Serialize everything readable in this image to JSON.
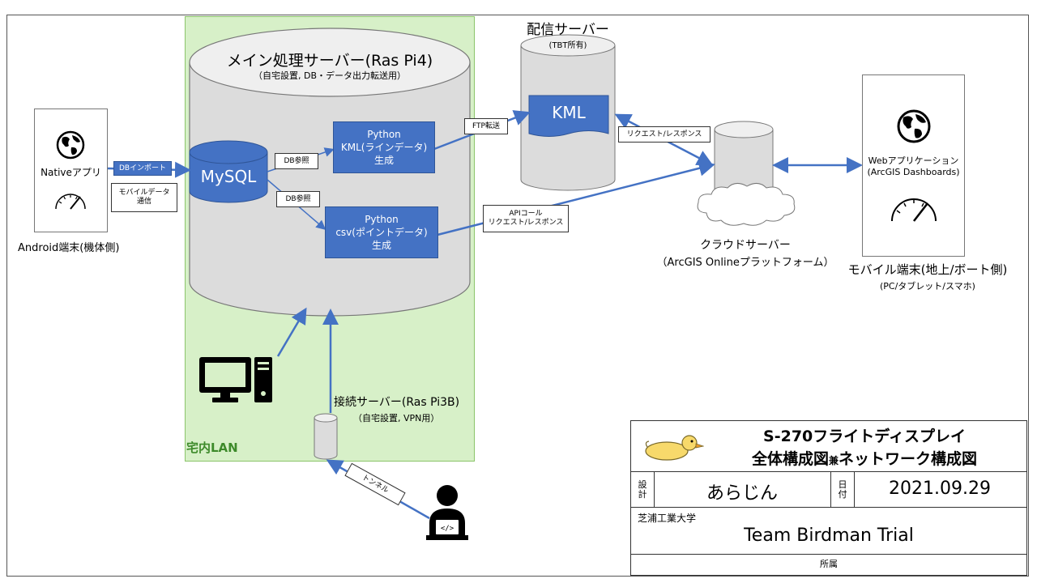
{
  "lan_label": "宅内LAN",
  "main_server": {
    "title": "メイン処理サーバー(Ras Pi4)",
    "subtitle": "（自宅設置, DB・データ出力転送用）"
  },
  "mysql_label": "MySQL",
  "python_kml": {
    "line1": "Python",
    "line2": "KML(ラインデータ)",
    "line3": "生成"
  },
  "python_csv": {
    "line1": "Python",
    "line2": "csv(ポイントデータ)",
    "line3": "生成"
  },
  "db_ref_1": "DB参照",
  "db_ref_2": "DB参照",
  "android": {
    "app_label": "Nativeアプリ",
    "caption": "Android端末(機体側)"
  },
  "db_import": "DBインポート",
  "mobile_comm": {
    "line1": "モバイルデータ",
    "line2": "通信"
  },
  "delivery_server": {
    "title": "配信サーバー",
    "subtitle": "(TBT所有)",
    "kml": "KML"
  },
  "ftp_transfer": "FTP転送",
  "request_response": "リクエスト/レスポンス",
  "api_call": {
    "line1": "APIコール",
    "line2": "リクエスト/レスポンス"
  },
  "cloud_server": {
    "title": "クラウドサーバー",
    "subtitle": "（ArcGIS Onlineプラットフォーム）"
  },
  "mobile": {
    "app_line1": "Webアプリケーション",
    "app_line2": "(ArcGIS Dashboards)",
    "caption": "モバイル端末(地上/ボート側)",
    "subcaption": "(PC/タブレット/スマホ)"
  },
  "connection_server": {
    "title": "接続サーバー(Ras Pi3B)",
    "subtitle": "（自宅設置, VPN用）"
  },
  "tunnel": "トンネル",
  "titleblock": {
    "title_line1": "S-270フライトディスプレイ",
    "title_line2a": "全体構成図",
    "title_line2b": "兼",
    "title_line2c": "ネットワーク構成図",
    "design_label_1": "設",
    "design_label_2": "計",
    "designer": "あらじん",
    "date_label_1": "日",
    "date_label_2": "付",
    "date": "2021.09.29",
    "org_small": "芝浦工業大学",
    "org": "Team Birdman Trial",
    "affiliation": "所属"
  },
  "colors": {
    "accent_blue": "#4472c4",
    "lan_green": "#d7f0c8",
    "arrow": "#4472c4"
  },
  "icons": [
    "globe-icon",
    "speedometer-icon",
    "desktop-pc-icon",
    "developer-icon",
    "duck-logo-icon"
  ]
}
